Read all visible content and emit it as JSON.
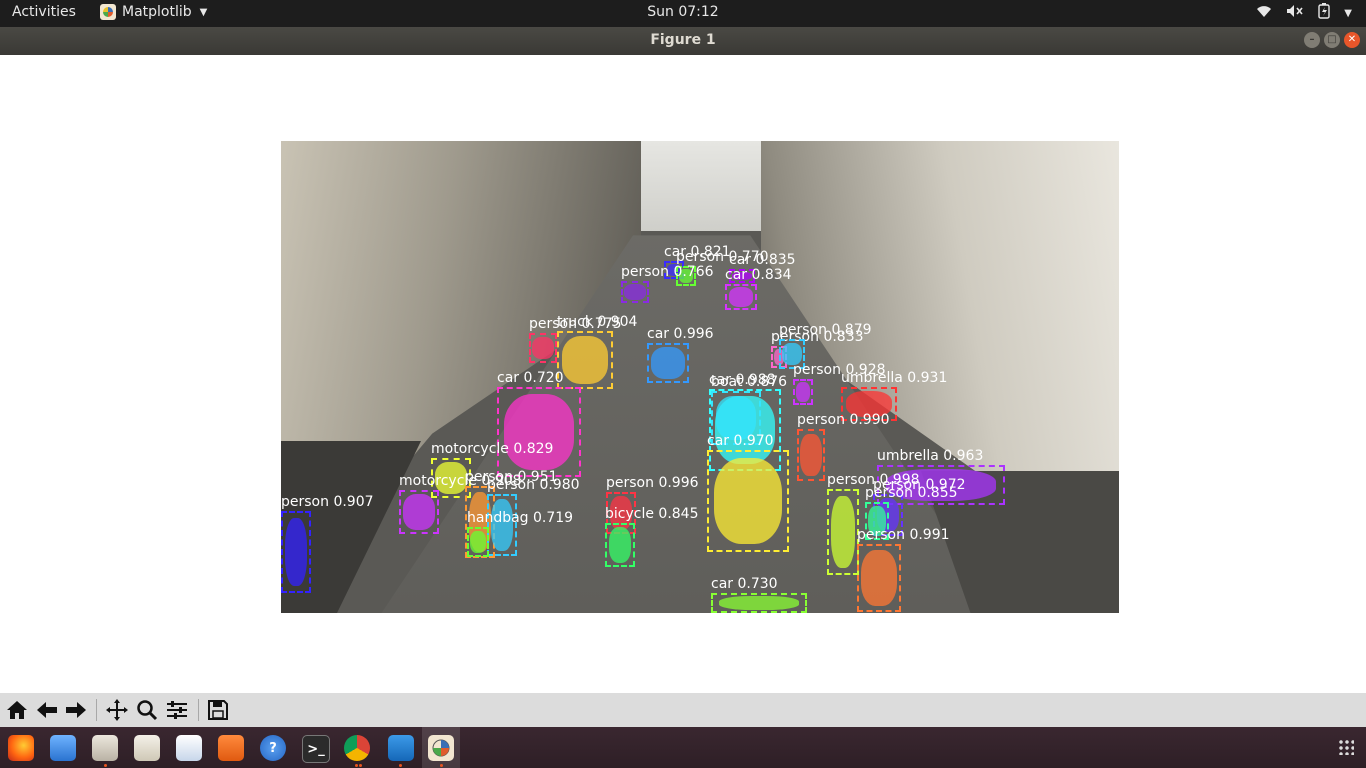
{
  "topbar": {
    "activities": "Activities",
    "app_name": "Matplotlib",
    "clock": "Sun 07:12"
  },
  "window": {
    "title": "Figure 1"
  },
  "detections": [
    {
      "label": "car 0.821",
      "color": "#3b2bff"
    },
    {
      "label": "car 0.835",
      "color": "#b300ff"
    },
    {
      "label": "person 0.770",
      "color": "#66ff33"
    },
    {
      "label": "person 0.766",
      "color": "#8a2be2"
    },
    {
      "label": "car 0.834",
      "color": "#d633ff"
    },
    {
      "label": "truck 0.904",
      "color": "#ffcc33"
    },
    {
      "label": "person 0.775",
      "color": "#ff3366"
    },
    {
      "label": "car 0.996",
      "color": "#3399ff"
    },
    {
      "label": "person 0.833",
      "color": "#ff66cc"
    },
    {
      "label": "person 0.879",
      "color": "#33ccff"
    },
    {
      "label": "car 0.720",
      "color": "#ff33cc"
    },
    {
      "label": "car 0.988",
      "color": "#33ffff"
    },
    {
      "label": "boat 0.876",
      "color": "#33e6ff"
    },
    {
      "label": "person 0.928",
      "color": "#cc33ff"
    },
    {
      "label": "umbrella 0.931",
      "color": "#ff3333"
    },
    {
      "label": "person 0.990",
      "color": "#ff5533"
    },
    {
      "label": "car 0.970",
      "color": "#ffee33"
    },
    {
      "label": "motorcycle 0.829",
      "color": "#eeff33"
    },
    {
      "label": "umbrella 0.963",
      "color": "#aa33ff"
    },
    {
      "label": "motorcycle 0.908",
      "color": "#cc33ff"
    },
    {
      "label": "person 0.951",
      "color": "#ff9933"
    },
    {
      "label": "person 0.980",
      "color": "#33ccff"
    },
    {
      "label": "person 0.998",
      "color": "#ccff33"
    },
    {
      "label": "person 0.972",
      "color": "#6633ff"
    },
    {
      "label": "person 0.855",
      "color": "#33ff99"
    },
    {
      "label": "person 0.907",
      "color": "#3322ff"
    },
    {
      "label": "person 0.996",
      "color": "#ff3344"
    },
    {
      "label": "handbag 0.719",
      "color": "#66ff33"
    },
    {
      "label": "bicycle 0.845",
      "color": "#33ff66"
    },
    {
      "label": "person 0.991",
      "color": "#ff7733"
    },
    {
      "label": "car 0.730",
      "color": "#88ff33"
    }
  ]
}
